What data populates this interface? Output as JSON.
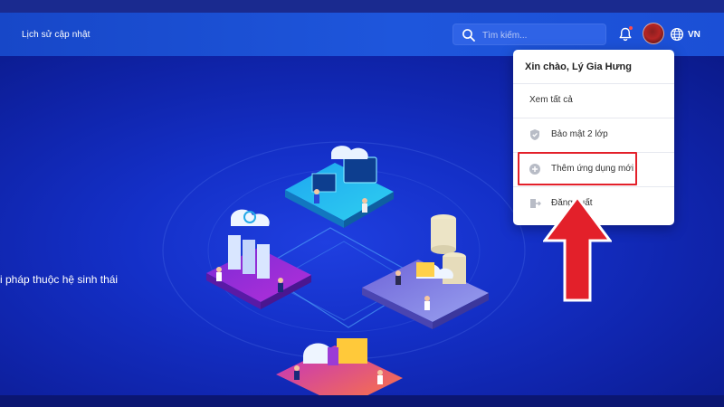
{
  "header": {
    "nav_link": "Lịch sử cập nhật",
    "search_placeholder": "Tìm kiếm...",
    "language": "VN"
  },
  "hero": {
    "tagline": "i pháp thuộc hệ sinh thái"
  },
  "dropdown": {
    "greeting": "Xin chào, Lý Gia Hưng",
    "items": [
      {
        "label": "Xem tất cả",
        "icon": "none"
      },
      {
        "label": "Bảo mật 2 lớp",
        "icon": "shield-icon"
      },
      {
        "label": "Thêm ứng dụng mới",
        "icon": "plus-circle-icon"
      },
      {
        "label": "Đăng xuất",
        "icon": "logout-icon"
      }
    ]
  },
  "annotation": {
    "highlight_color": "#e3202a",
    "arrow_color": "#e3202a"
  },
  "colors": {
    "header_bg": "#1e56dc",
    "hero_bg": "#1430c8",
    "search_bg": "#2f63e6"
  }
}
